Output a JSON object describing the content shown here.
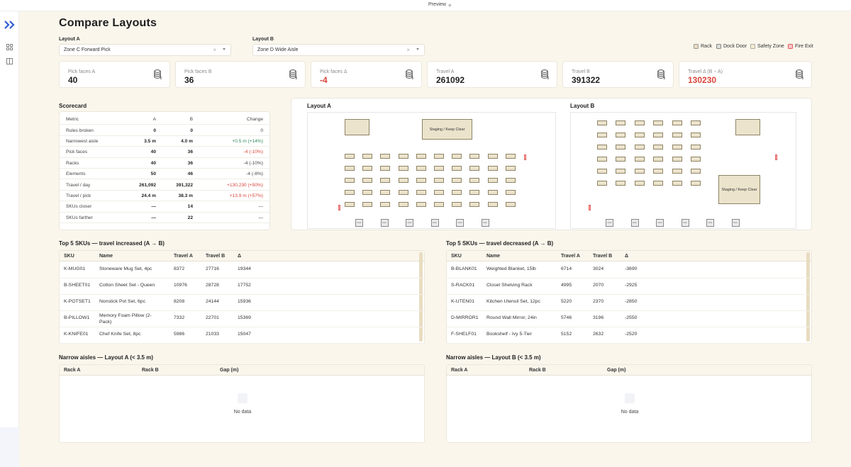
{
  "topbar": {
    "preview_label": "Preview"
  },
  "page_title": "Compare Layouts",
  "layout_a": {
    "label": "Layout A",
    "value": "Zone C Forward Pick"
  },
  "layout_b": {
    "label": "Layout B",
    "value": "Zone D Wide Aisle"
  },
  "legend": [
    {
      "label": "Rack",
      "color": "#e8dcc0",
      "border": "#999999"
    },
    {
      "label": "Dock Door",
      "color": "#dddddd",
      "border": "#888888"
    },
    {
      "label": "Safety Zone",
      "color": "#f3ecd3",
      "border": "#aaaaaa"
    },
    {
      "label": "Fire Exit",
      "color": "#f7c6c6",
      "border": "#e25b5b"
    }
  ],
  "metrics": [
    {
      "label": "Pick faces A",
      "value": "40"
    },
    {
      "label": "Pick faces B",
      "value": "36"
    },
    {
      "label": "Pick faces Δ",
      "value": "-4",
      "accent": "#d9443a"
    },
    {
      "label": "Travel A",
      "value": "261092"
    },
    {
      "label": "Travel B",
      "value": "391322"
    },
    {
      "label": "Travel Δ (B − A)",
      "value": "130230",
      "accent": "#d9443a"
    }
  ],
  "scorecard": {
    "title": "Scorecard",
    "headers": [
      "Metric",
      "A",
      "B",
      "Change"
    ],
    "rows": [
      [
        "Rules broken",
        "0",
        "0",
        "0"
      ],
      [
        "Narrowest aisle",
        "3.5 m",
        "4.0 m",
        "+0.5 m (+14%)"
      ],
      [
        "Pick faces",
        "40",
        "36",
        "-4 (-10%)"
      ],
      [
        "Racks",
        "40",
        "36",
        "-4 (-10%)"
      ],
      [
        "Elements",
        "50",
        "46",
        "-4 (-8%)"
      ],
      [
        "Travel / day",
        "261,092",
        "391,322",
        "+130,230 (+50%)"
      ],
      [
        "Travel / pick",
        "24.4 m",
        "38.3 m",
        "+13.9 m (+57%)"
      ],
      [
        "SKUs closer",
        "—",
        "14",
        "—"
      ],
      [
        "SKUs farther",
        "—",
        "22",
        "—"
      ]
    ],
    "change_tone": [
      "neutral",
      "good",
      "bad",
      "neutral",
      "neutral",
      "bad",
      "bad",
      "neutral",
      "neutral"
    ]
  },
  "canvas": {
    "layout_a_title": "Layout A",
    "layout_b_title": "Layout B",
    "staging_label": "Staging / Keep Clear",
    "dock_label": "Dock"
  },
  "top_increased": {
    "title": "Top 5 SKUs — travel increased (A → B)",
    "headers": [
      "SKU",
      "Name",
      "Travel A",
      "Travel B",
      "Δ"
    ],
    "rows": [
      [
        "K-MUG01",
        "Stoneware Mug Set, 4pc",
        "8372",
        "27716",
        "19344"
      ],
      [
        "B-SHEET01",
        "Cotton Sheet Set - Queen",
        "10976",
        "28728",
        "17752"
      ],
      [
        "K-POTSET1",
        "Nonstick Pot Set, 6pc",
        "8208",
        "24144",
        "15936"
      ],
      [
        "B-PILLOW1",
        "Memory Foam Pillow (2-Pack)",
        "7332",
        "22701",
        "15369"
      ],
      [
        "K-KNIFE01",
        "Chef Knife Set, 8pc",
        "5986",
        "21033",
        "15047"
      ]
    ]
  },
  "top_decreased": {
    "title": "Top 5 SKUs — travel decreased (A → B)",
    "headers": [
      "SKU",
      "Name",
      "Travel A",
      "Travel B",
      "Δ"
    ],
    "rows": [
      [
        "B-BLANK01",
        "Weighted Blanket, 15lb",
        "6714",
        "3024",
        "-3690"
      ],
      [
        "S-RACK01",
        "Closet Shelving Rack",
        "4995",
        "2070",
        "-2925"
      ],
      [
        "K-UTEN01",
        "Kitchen Utensil Set, 12pc",
        "5220",
        "2370",
        "-2850"
      ],
      [
        "D-MIRROR1",
        "Round Wall Mirror, 24in",
        "5746",
        "3196",
        "-2550"
      ],
      [
        "F-SHELF01",
        "Bookshelf - Ivy 5-Tier",
        "5152",
        "2632",
        "-2520"
      ]
    ]
  },
  "narrow_a": {
    "title": "Narrow aisles — Layout A (< 3.5 m)",
    "headers": [
      "Rack A",
      "Rack B",
      "Gap (m)"
    ],
    "empty": "No data"
  },
  "narrow_b": {
    "title": "Narrow aisles — Layout B (< 3.5 m)",
    "headers": [
      "Rack A",
      "Rack B",
      "Gap (m)"
    ],
    "empty": "No data"
  }
}
